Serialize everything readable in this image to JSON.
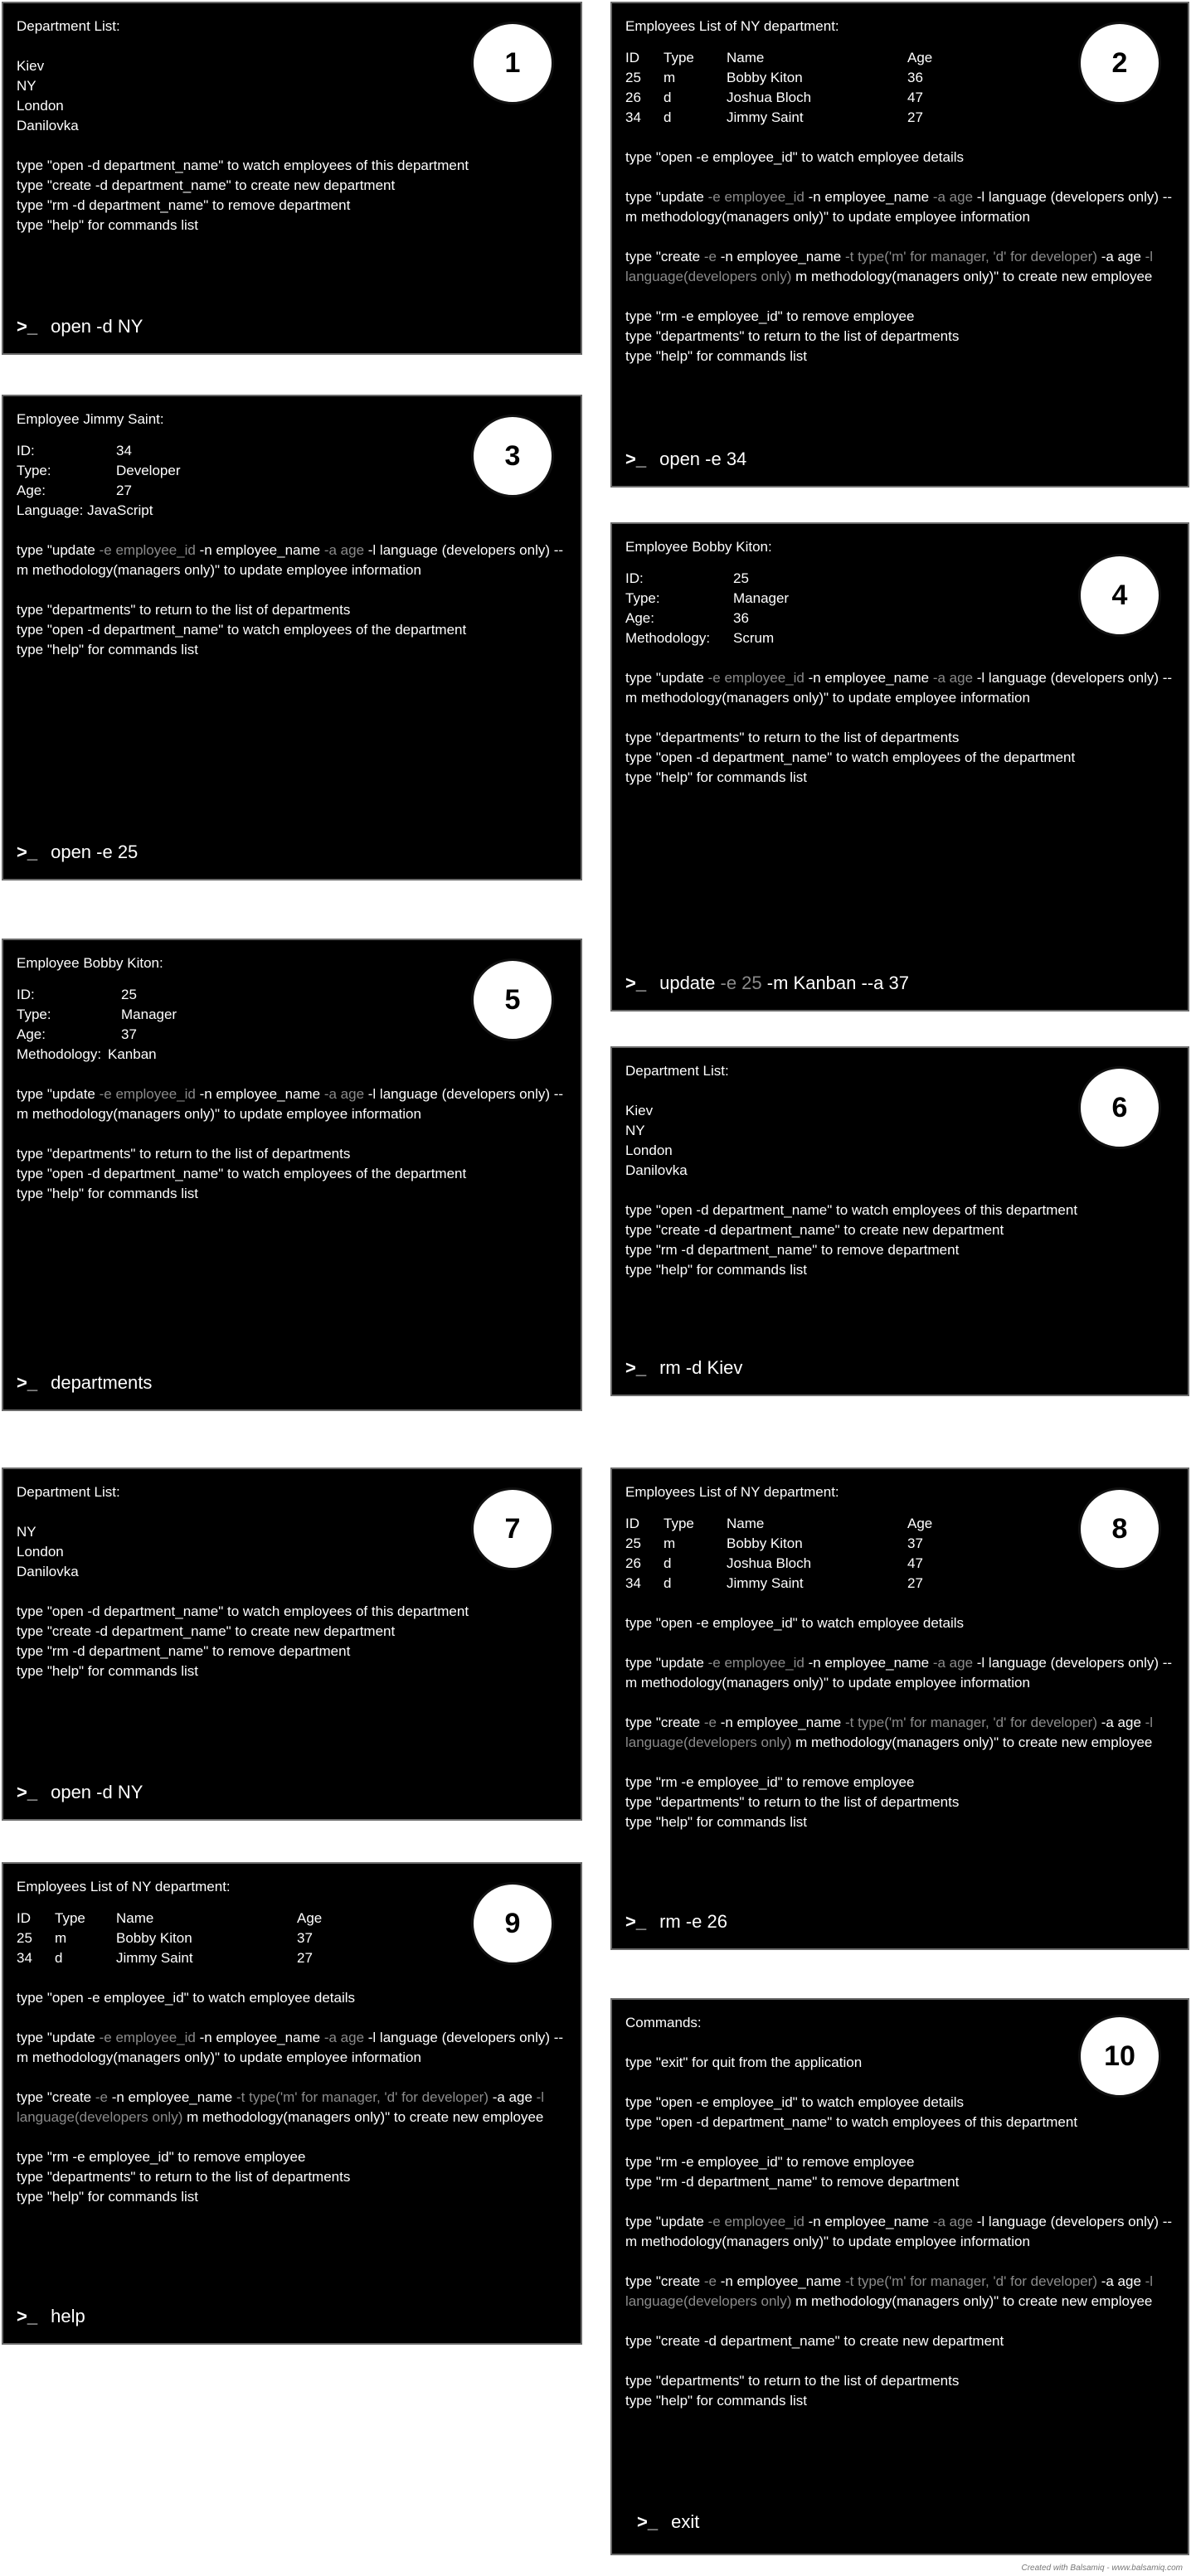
{
  "footer": "Created with Balsamiq - www.balsamiq.com",
  "cmds": {
    "open_d": "type \"open -d department_name\" to watch employees of this department",
    "open_d_the": "type \"open -d department_name\" to watch employees of the department",
    "create_d": "type \"create -d department_name\" to create new department",
    "rm_d": "type \"rm -d department_name\" to remove department",
    "help": "type \"help\" for commands list",
    "open_e": "type \"open -e employee_id\" to watch employee details",
    "rm_e": "type \"rm -e employee_id\" to remove employee",
    "departments": "type \"departments\" to return to the list of departments",
    "exit": "type \"exit\" for quit from the application",
    "update": {
      "p1": "type \"update ",
      "g1": "-e employee_id",
      "p2": " -n employee_name ",
      "g2": "-a age",
      "p3": " -l language (developers only) --m methodology(managers only)\" to update employee information"
    },
    "create_e": {
      "p1": "type \"create ",
      "g1": "-e",
      "p2": " -n employee_name ",
      "g2": "-t type('m' for manager, 'd' for developer)",
      "p3": " -a age ",
      "g3": "-l language(developers only)",
      "p4": " m methodology(managers only)\" to create new employee"
    }
  },
  "panels": [
    {
      "num": "1",
      "title": "Department List:",
      "departments": [
        "Kiev",
        "NY",
        "London",
        "Danilovka"
      ],
      "prompt_sym": ">_",
      "prompt": "open -d NY"
    },
    {
      "num": "2",
      "title": "Employees List of NY department:",
      "headers": [
        "ID",
        "Type",
        "Name",
        "Age"
      ],
      "rows": [
        [
          "25",
          "m",
          "Bobby Kiton",
          "36"
        ],
        [
          "26",
          "d",
          "Joshua Bloch",
          "47"
        ],
        [
          "34",
          "d",
          "Jimmy Saint",
          "27"
        ]
      ],
      "prompt_sym": ">_",
      "prompt": "open -e 34"
    },
    {
      "num": "3",
      "title": "Employee Jimmy Saint:",
      "details": [
        [
          "ID:",
          "34"
        ],
        [
          "Type:",
          "Developer"
        ],
        [
          "Age:",
          "27"
        ]
      ],
      "extra": "Language: JavaScript",
      "prompt_sym": ">_",
      "prompt": "open -e 25"
    },
    {
      "num": "4",
      "title": "Employee Bobby Kiton:",
      "details": [
        [
          "ID:",
          "25"
        ],
        [
          "Type:",
          "Manager"
        ],
        [
          "Age:",
          "36"
        ],
        [
          "Methodology:",
          "Scrum"
        ]
      ],
      "prompt_sym": ">_",
      "prompt_a": "update ",
      "prompt_g": "-e 25",
      "prompt_b": " -m Kanban --a 37"
    },
    {
      "num": "5",
      "title": "Employee Bobby Kiton:",
      "details": [
        [
          "ID:",
          "25"
        ],
        [
          "Type:",
          "Manager"
        ],
        [
          "Age:",
          "37"
        ],
        [
          "Methodology:",
          "Kanban"
        ]
      ],
      "prompt_sym": ">_",
      "prompt": "departments"
    },
    {
      "num": "6",
      "title": "Department List:",
      "departments": [
        "Kiev",
        "NY",
        "London",
        "Danilovka"
      ],
      "prompt_sym": ">_",
      "prompt": "rm -d Kiev"
    },
    {
      "num": "7",
      "title": "Department List:",
      "departments": [
        "NY",
        "London",
        "Danilovka"
      ],
      "prompt_sym": ">_",
      "prompt": "open -d NY"
    },
    {
      "num": "8",
      "title": "Employees List of NY department:",
      "headers": [
        "ID",
        "Type",
        "Name",
        "Age"
      ],
      "rows": [
        [
          "25",
          "m",
          "Bobby Kiton",
          "37"
        ],
        [
          "26",
          "d",
          "Joshua Bloch",
          "47"
        ],
        [
          "34",
          "d",
          "Jimmy Saint",
          "27"
        ]
      ],
      "prompt_sym": ">_",
      "prompt": "rm -e 26"
    },
    {
      "num": "9",
      "title": "Employees List of NY department:",
      "headers": [
        "ID",
        "Type",
        "Name",
        "Age"
      ],
      "rows": [
        [
          "25",
          "m",
          "Bobby Kiton",
          "37"
        ],
        [
          "34",
          "d",
          "Jimmy Saint",
          "27"
        ]
      ],
      "prompt_sym": ">_",
      "prompt": "help"
    },
    {
      "num": "10",
      "title": "Commands:",
      "prompt_sym": ">_",
      "prompt": "exit"
    }
  ]
}
